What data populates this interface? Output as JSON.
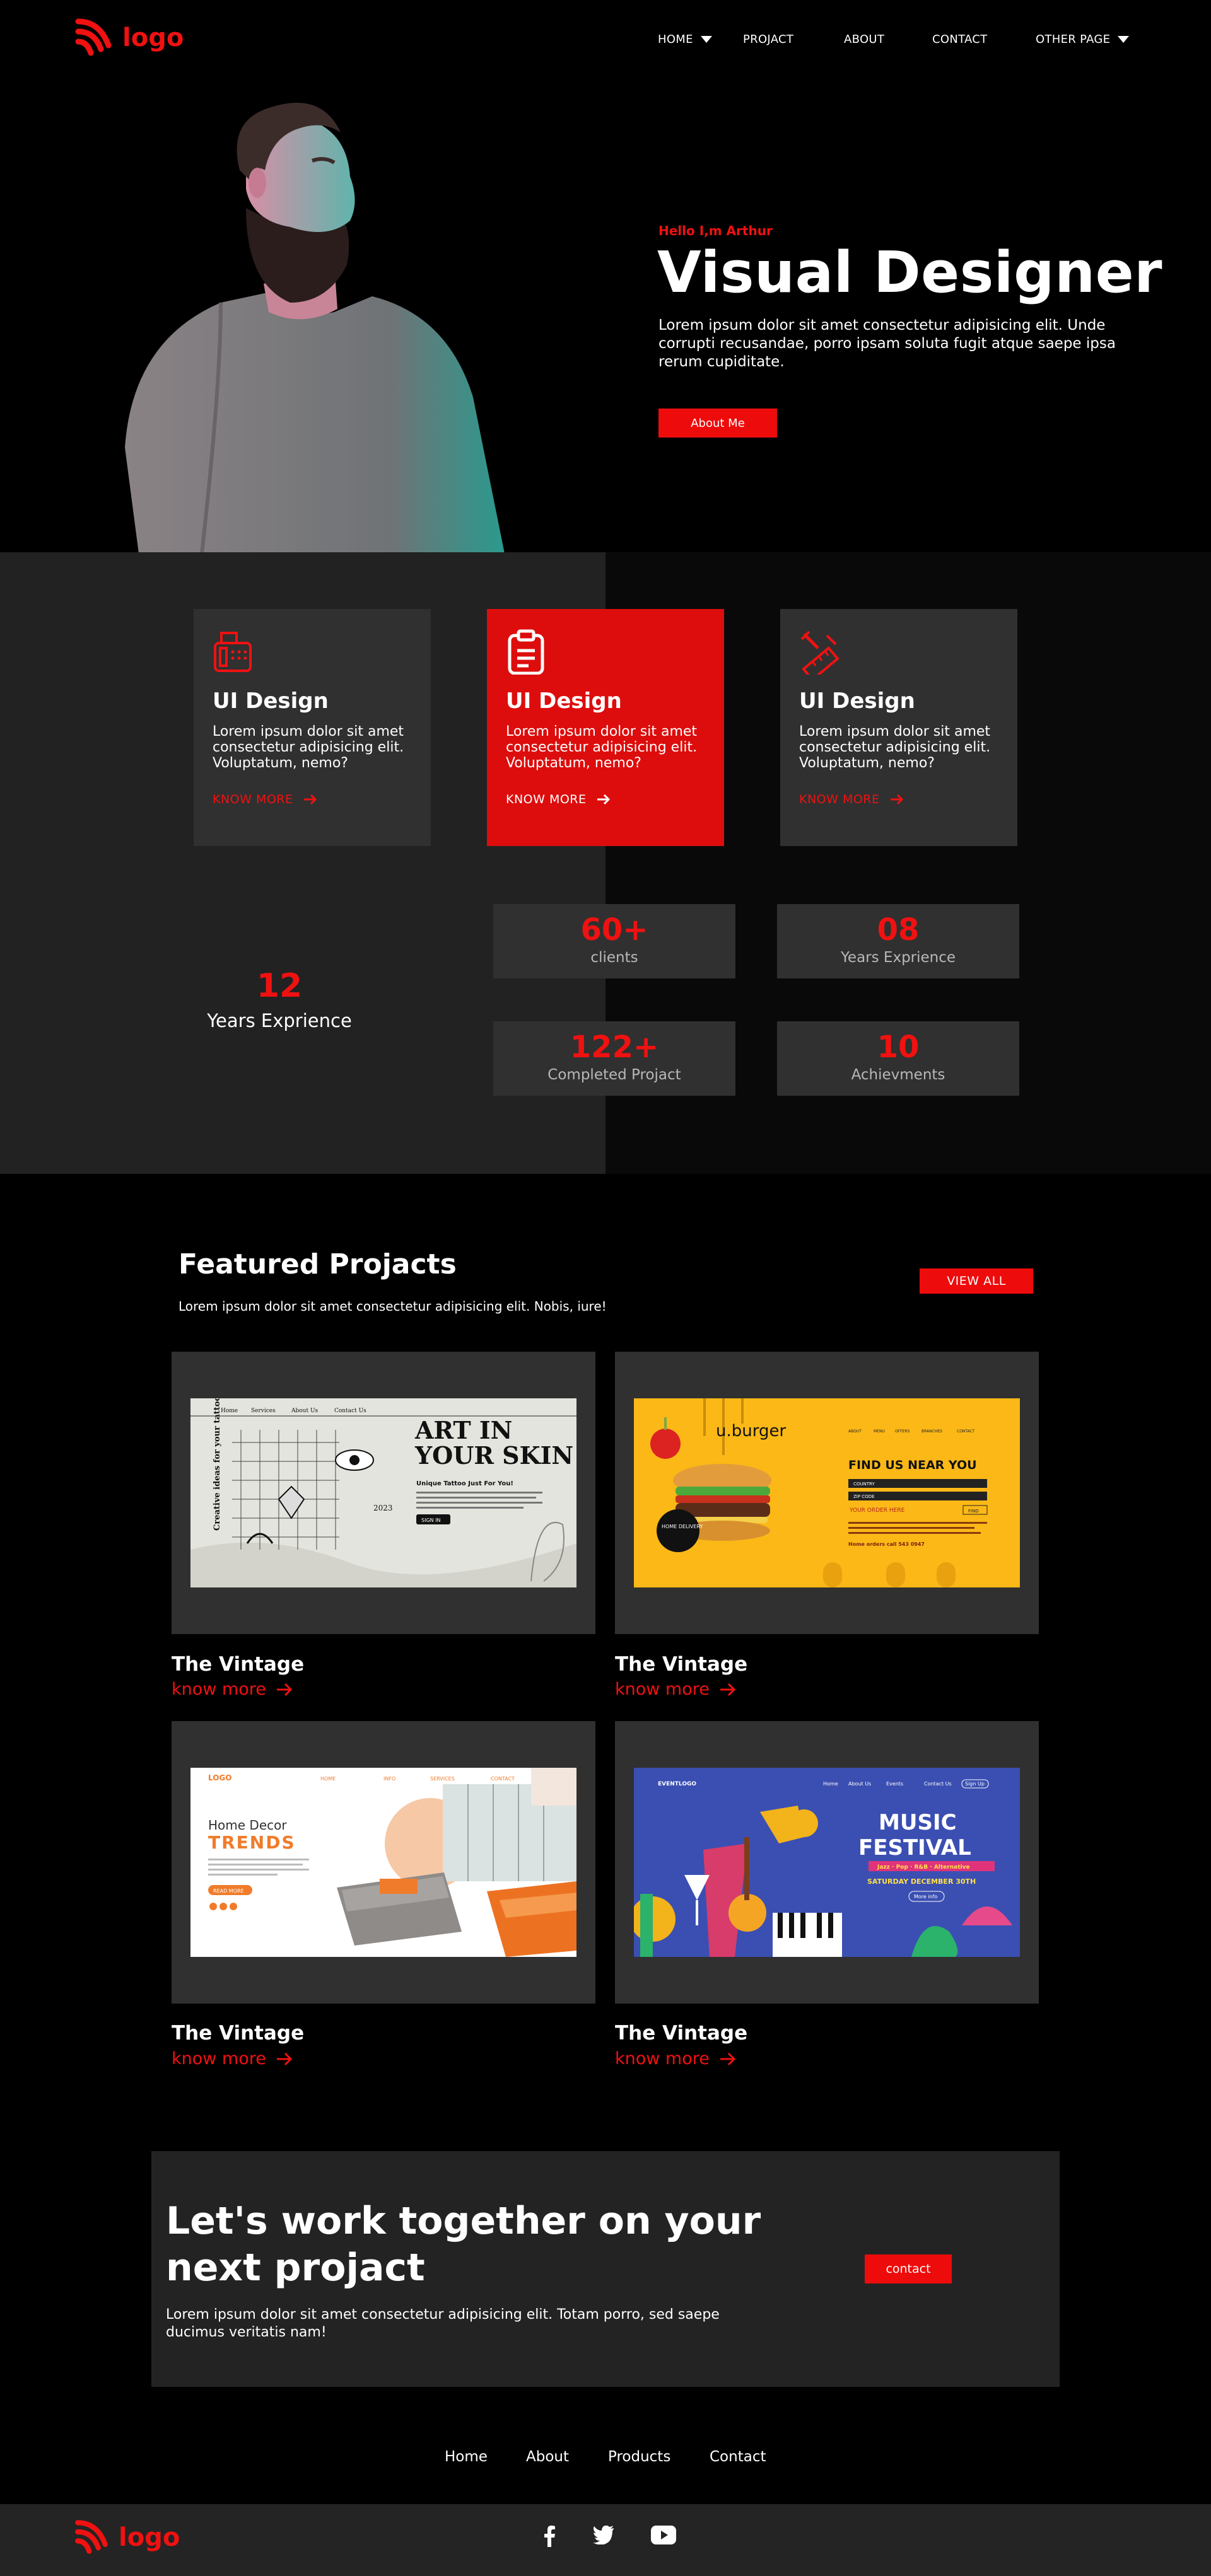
{
  "nav": {
    "logo_text": "logo",
    "items": [
      {
        "label": "HOME",
        "has_dropdown": true
      },
      {
        "label": "PROJACT",
        "has_dropdown": false
      },
      {
        "label": "ABOUT",
        "has_dropdown": false
      },
      {
        "label": "CONTACT",
        "has_dropdown": false
      },
      {
        "label": "OTHER PAGE",
        "has_dropdown": true
      }
    ]
  },
  "hero": {
    "eyebrow": "Hello I,m Arthur",
    "title": "Visual Designer",
    "description": "Lorem ipsum dolor sit amet consectetur adipisicing elit. Unde corrupti recusandae, porro ipsam soluta fugit atque saepe ipsa rerum cupiditate.",
    "button_label": "About Me",
    "image": "portrait-photo"
  },
  "services": [
    {
      "icon": "fax-icon",
      "title": "UI Design",
      "description": "Lorem ipsum dolor sit amet consectetur adipisicing elit. Voluptatum, nemo?",
      "link": "KNOW MORE",
      "active": false
    },
    {
      "icon": "clipboard-icon",
      "title": "UI Design",
      "description": "Lorem ipsum dolor sit amet consectetur adipisicing elit. Voluptatum, nemo?",
      "link": "KNOW MORE",
      "active": true
    },
    {
      "icon": "ruler-pencil-icon",
      "title": "UI Design",
      "description": "Lorem ipsum dolor sit amet consectetur adipisicing elit. Voluptatum, nemo?",
      "link": "KNOW MORE",
      "active": false
    }
  ],
  "experience": {
    "value": "12",
    "label": "Years Exprience"
  },
  "stats": [
    {
      "value": "60+",
      "label": "clients"
    },
    {
      "value": "08",
      "label": "Years Exprience"
    },
    {
      "value": "122+",
      "label": "Completed Projact"
    },
    {
      "value": "10",
      "label": "Achievments"
    }
  ],
  "featured": {
    "title": "Featured Projacts",
    "subtitle": "Lorem ipsum dolor sit amet consectetur adipisicing elit. Nobis, iure!",
    "view_all": "VIEW ALL",
    "projects": [
      {
        "title": "The Vintage",
        "link": "know more",
        "shot": {
          "nav": [
            "Home",
            "Services",
            "About Us",
            "Contact Us"
          ],
          "headline1": "ART IN",
          "headline2": "YOUR SKIN",
          "side": "Creative ideas for your tattoo",
          "tagline": "Unique Tattoo Just For You!",
          "button": "SIGN IN",
          "badge": "2023"
        }
      },
      {
        "title": "The Vintage",
        "link": "know more",
        "shot": {
          "brand": "u.burger",
          "nav": [
            "ABOUT",
            "MENU",
            "OFFERS",
            "BRANCHES",
            "CONTACT"
          ],
          "headline": "FIND US NEAR YOU",
          "fields": [
            "COUNTRY",
            "ZIP CODE"
          ],
          "order": "YOUR ORDER HERE",
          "find": "FIND",
          "badge": "HOME DELIVERY",
          "phone": "Home orders call 543 0947"
        }
      },
      {
        "title": "The Vintage",
        "link": "know more",
        "shot": {
          "brand": "LOGO",
          "nav": [
            "HOME",
            "INFO",
            "SERVICES",
            "CONTACT"
          ],
          "headline1": "Home Decor",
          "headline2": "TRENDS",
          "button": "READ MORE"
        }
      },
      {
        "title": "The Vintage",
        "link": "know more",
        "shot": {
          "brand": "EVENTLOGO",
          "nav": [
            "Home",
            "About Us",
            "Events",
            "Contact Us",
            "Sign Up"
          ],
          "headline1": "MUSIC",
          "headline2": "FESTIVAL",
          "genres": "Jazz · Pop · R&B · Alternative",
          "date": "SATURDAY DECEMBER 30TH",
          "button": "More info"
        }
      }
    ]
  },
  "cta": {
    "title": "Let's work together on your next projact",
    "description": "Lorem ipsum dolor sit amet consectetur adipisicing elit. Totam porro, sed saepe ducimus veritatis nam!",
    "button_label": "contact"
  },
  "footer": {
    "nav": [
      "Home",
      "About",
      "Products",
      "Contact"
    ],
    "logo_text": "logo",
    "social": [
      "facebook-icon",
      "twitter-icon",
      "youtube-icon"
    ]
  },
  "colors": {
    "accent": "#f01111",
    "card": "#303030",
    "panel": "#222222",
    "background": "#000000"
  }
}
